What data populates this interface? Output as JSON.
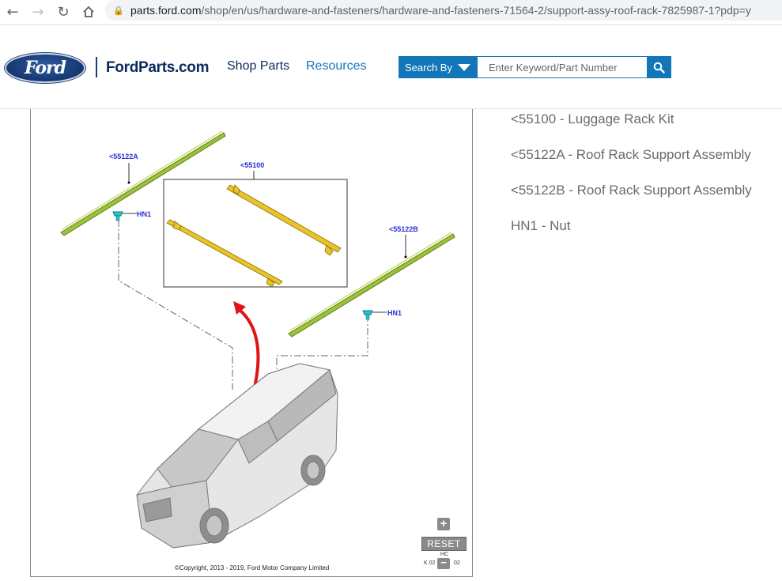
{
  "browser": {
    "url_host": "parts.ford.com",
    "url_path": "/shop/en/us/hardware-and-fasteners/hardware-and-fasteners-71564-2/support-assy-roof-rack-7825987-1?pdp=y"
  },
  "header": {
    "logo_text": "Ford",
    "brand": "FordParts.com",
    "nav": {
      "shop": "Shop Parts",
      "resources": "Resources"
    },
    "search": {
      "by_label": "Search By",
      "placeholder": "Enter Keyword/Part Number"
    },
    "colors": {
      "primary_blue": "#1276b8",
      "navy": "#0a2a5e"
    }
  },
  "diagram": {
    "callouts": {
      "a": "<55122A",
      "kit": "<55100",
      "b": "<55122B",
      "hn1_left": "HN1",
      "hn1_right": "HN1"
    },
    "copyright": "©Copyright, 2013 - 2019, Ford Motor Company Limited",
    "code_left": "K 02",
    "code_right": "02",
    "code_hc": "HC",
    "controls": {
      "reset": "RESET",
      "plus": "+",
      "minus": "−"
    }
  },
  "parts": [
    "<55100 - Luggage Rack Kit",
    "<55122A - Roof Rack Support Assembly",
    "<55122B - Roof Rack Support Assembly",
    "HN1 - Nut"
  ]
}
